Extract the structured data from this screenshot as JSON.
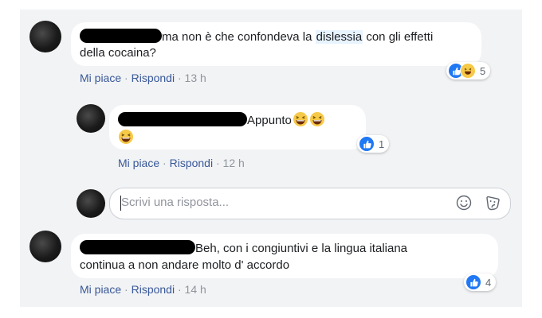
{
  "comments": [
    {
      "text_line1": "ma non è che confondeva la ",
      "highlight": "dislessia",
      "text_line1_end": " con gli effetti",
      "text_line2": "della cocaina?",
      "like_label": "Mi piace",
      "reply_label": "Rispondi",
      "time": "13 h",
      "reaction_count": "5",
      "reaction_icons": [
        "like-icon",
        "haha-icon"
      ]
    },
    {
      "text": "Appunto",
      "like_label": "Mi piace",
      "reply_label": "Rispondi",
      "time": "12 h",
      "reaction_count": "1",
      "reaction_icons": [
        "like-icon"
      ],
      "emojis": [
        "grinning-squinting-face",
        "grinning-squinting-face",
        "grinning-squinting-face"
      ]
    },
    {
      "text_line1": "Beh, con i congiuntivi e la lingua italiana",
      "text_line2": "continua a non andare molto d' accordo",
      "like_label": "Mi piace",
      "reply_label": "Rispondi",
      "time": "14 h",
      "reaction_count": "4",
      "reaction_icons": [
        "like-icon"
      ]
    }
  ],
  "reply_box": {
    "placeholder": "Scrivi una risposta...",
    "icons": [
      "smiley-icon",
      "sticker-icon"
    ]
  },
  "separator": "·",
  "colors": {
    "link": "#385898",
    "meta": "#90949c",
    "like_blue": "#2078f4",
    "bg": "#f2f3f5"
  }
}
